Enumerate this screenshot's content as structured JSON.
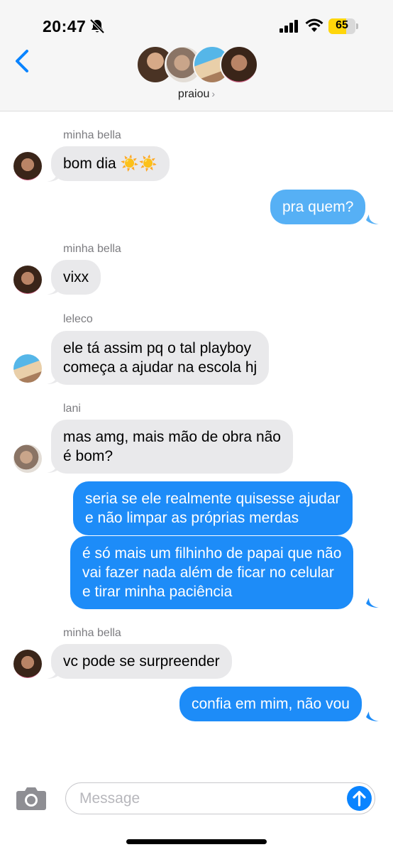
{
  "status_bar": {
    "time": "20:47",
    "battery": "65",
    "battery_fraction": 0.65,
    "icons": [
      "bell-slash-icon",
      "cellular-signal-icon",
      "wifi-icon",
      "battery-icon"
    ]
  },
  "header": {
    "group_name": "praiou",
    "chevron": "›",
    "back_icon": "chevron-left-icon"
  },
  "messages": [
    {
      "sender": "minha bella",
      "direction": "in",
      "text": "bom dia ☀️☀️"
    },
    {
      "direction": "out",
      "text": "pra quem?"
    },
    {
      "sender": "minha bella",
      "direction": "in",
      "text": "vixx"
    },
    {
      "sender": "leleco",
      "direction": "in",
      "lines": [
        "ele tá assim pq o tal playboy",
        "começa a ajudar na escola hj"
      ]
    },
    {
      "sender": "lani",
      "direction": "in",
      "lines": [
        "mas amg, mais mão de obra não",
        "é bom?"
      ]
    },
    {
      "direction": "out",
      "lines": [
        "seria se ele realmente quisesse ajudar",
        "e não limpar as próprias merdas"
      ]
    },
    {
      "direction": "out",
      "lines": [
        "é só mais um filhinho de papai que não",
        "vai fazer nada além de ficar no celular",
        "e tirar minha paciência"
      ]
    },
    {
      "sender": "minha bella",
      "direction": "in",
      "text": "vc pode se surpreender"
    },
    {
      "direction": "out",
      "text": "confia em mim, não vou"
    }
  ],
  "input_bar": {
    "placeholder": "Message",
    "camera_icon": "camera-icon",
    "send_icon": "arrow-up-icon"
  },
  "colors": {
    "outgoing_bubble": "#1d8cf8",
    "incoming_bubble": "#e9e9eb",
    "accent": "#0a84ff"
  }
}
